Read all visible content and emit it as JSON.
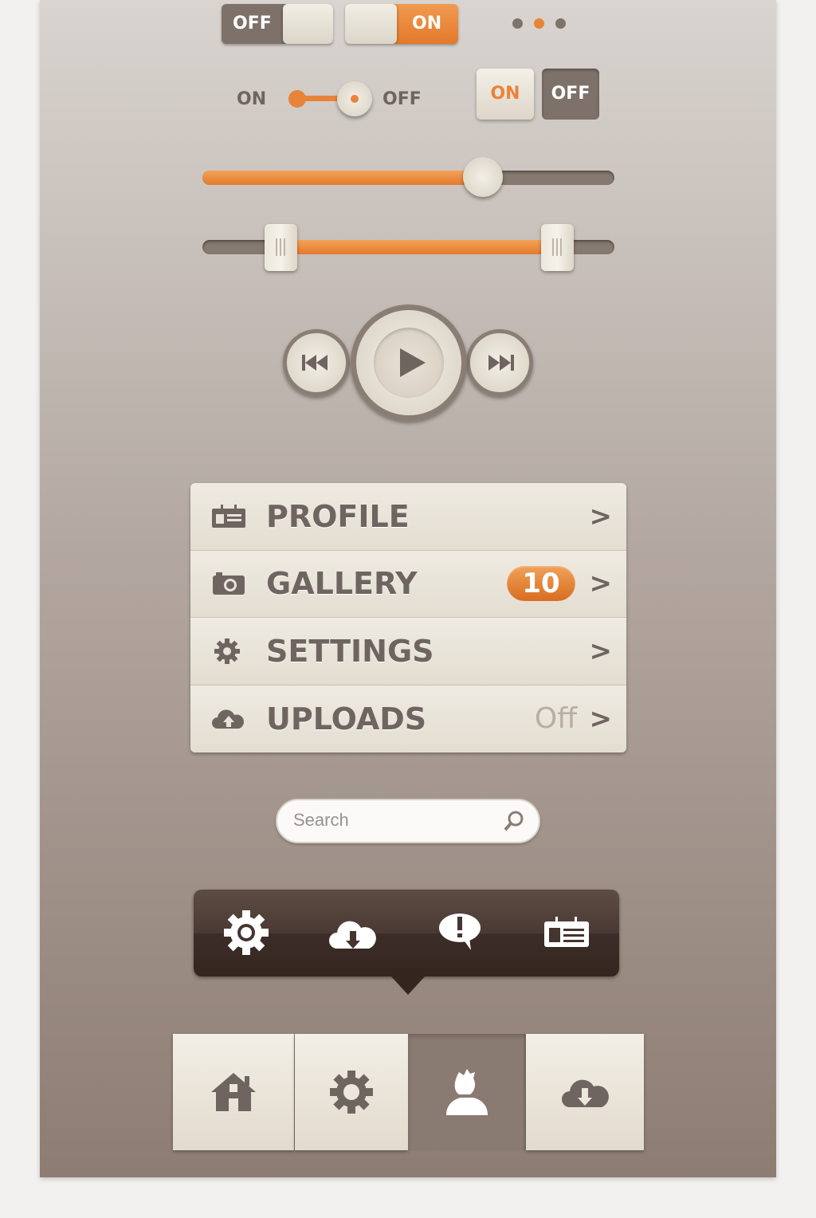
{
  "colors": {
    "accent": "#e8843a",
    "dark": "#7d716a",
    "cream": "#ece7dc",
    "tooltip": "#3c2d28"
  },
  "toggles": {
    "toggle1": {
      "label": "OFF",
      "state": "off"
    },
    "toggle2": {
      "label": "ON",
      "state": "on"
    },
    "page_dots": {
      "count": 3,
      "active": 2
    },
    "radio_switch": {
      "on_label": "ON",
      "off_label": "OFF",
      "state": "off"
    },
    "segmented": {
      "on_label": "ON",
      "off_label": "OFF",
      "selected": "ON"
    }
  },
  "slider": {
    "value_percent": 68
  },
  "range_slider": {
    "low_percent": 19,
    "high_percent": 86
  },
  "media": {
    "prev": "previous-icon",
    "play": "play-icon",
    "next": "next-icon"
  },
  "menu": {
    "items": [
      {
        "label": "PROFILE",
        "icon": "id-card-icon"
      },
      {
        "label": "GALLERY",
        "icon": "camera-icon",
        "badge": "10"
      },
      {
        "label": "SETTINGS",
        "icon": "gear-icon"
      },
      {
        "label": "UPLOADS",
        "icon": "cloud-upload-icon",
        "value": "Off"
      }
    ]
  },
  "search": {
    "placeholder": "Search",
    "value": ""
  },
  "tooltip_bar": {
    "icons": [
      "gear-icon",
      "cloud-download-icon",
      "alert-bubble-icon",
      "id-card-icon"
    ]
  },
  "tab_bar": {
    "tabs": [
      {
        "icon": "home-icon"
      },
      {
        "icon": "gear-icon"
      },
      {
        "icon": "user-icon",
        "active": true
      },
      {
        "icon": "cloud-download-icon"
      }
    ]
  }
}
